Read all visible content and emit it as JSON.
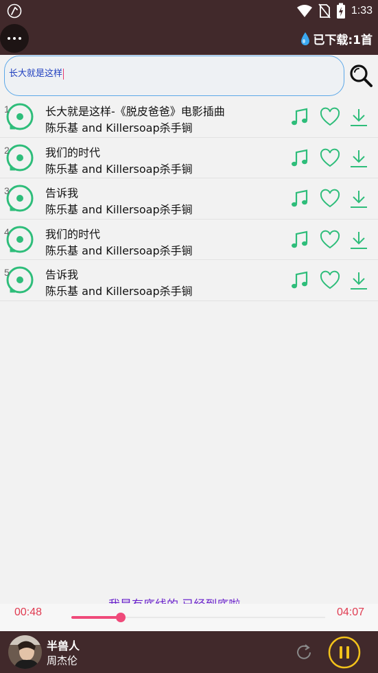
{
  "status_bar": {
    "time": "1:33",
    "icons": [
      "app-notification-icon",
      "wifi-icon",
      "no-sim-icon",
      "battery-charging-icon"
    ]
  },
  "header": {
    "downloaded_label": "已下载:1首"
  },
  "search": {
    "value": "长大就是这样"
  },
  "songs": [
    {
      "index": "1",
      "title": "长大就是这样-《脱皮爸爸》电影插曲",
      "artist": "陈乐基 and Killersoap杀手锏"
    },
    {
      "index": "2",
      "title": "我们的时代",
      "artist": "陈乐基 and Killersoap杀手锏"
    },
    {
      "index": "3",
      "title": "告诉我",
      "artist": "陈乐基 and Killersoap杀手锏"
    },
    {
      "index": "4",
      "title": "我们的时代",
      "artist": "陈乐基 and Killersoap杀手锏"
    },
    {
      "index": "5",
      "title": "告诉我",
      "artist": "陈乐基 and Killersoap杀手锏"
    }
  ],
  "lyric": {
    "text": "我是有底线的 已经到底啦"
  },
  "progress": {
    "current": "00:48",
    "total": "04:07",
    "fraction": 0.194
  },
  "player": {
    "title": "半兽人",
    "artist": "周杰伦"
  },
  "colors": {
    "header_bg": "#41292b",
    "accent_green": "#2ebd7a",
    "accent_pink": "#ef4a7a",
    "time_red": "#e03a50",
    "pause_yellow": "#f2c21b",
    "search_text": "#1f3fbf"
  }
}
